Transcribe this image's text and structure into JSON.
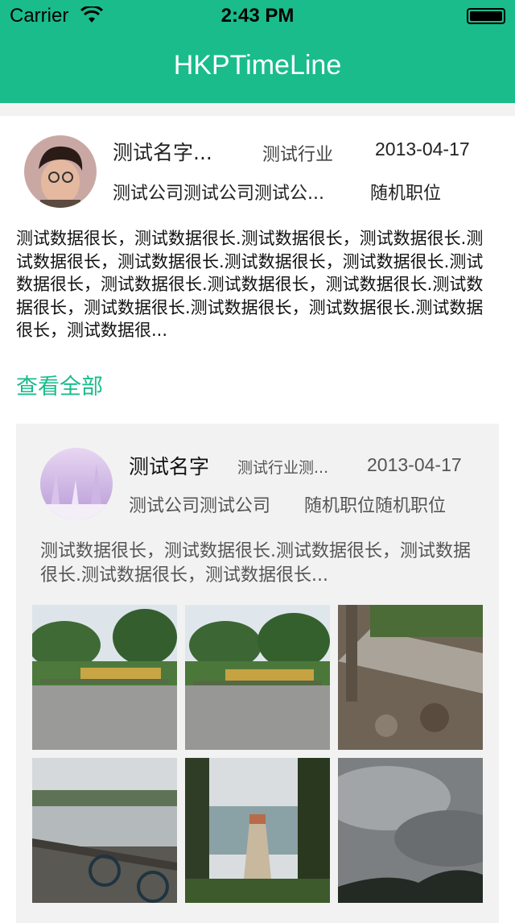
{
  "status_bar": {
    "carrier": "Carrier",
    "time": "2:43 PM"
  },
  "nav": {
    "title": "HKPTimeLine"
  },
  "post": {
    "name": "测试名字...",
    "industry": "测试行业",
    "date": "2013-04-17",
    "company": "测试公司测试公司测试公...",
    "position": "随机职位",
    "content": "测试数据很长，测试数据很长.测试数据很长，测试数据很长.测试数据很长，测试数据很长.测试数据很长，测试数据很长.测试数据很长，测试数据很长.测试数据很长，测试数据很长.测试数据很长，测试数据很长.测试数据很长，测试数据很长.测试数据很长，测试数据很...",
    "view_all": "查看全部"
  },
  "repost": {
    "name": "测试名字",
    "industry": "测试行业测...",
    "date": "2013-04-17",
    "company": "测试公司测试公司",
    "position": "随机职位随机职位",
    "content": "测试数据很长，测试数据很长.测试数据很长，测试数据很长.测试数据很长，测试数据很长...",
    "photos": [
      "park-photo",
      "park-photo",
      "shaded-path-photo",
      "lake-railing-photo",
      "lake-pier-photo",
      "cloudy-sky-photo"
    ]
  },
  "colors": {
    "accent": "#1abc8c",
    "card_bg": "#f2f2f2"
  }
}
